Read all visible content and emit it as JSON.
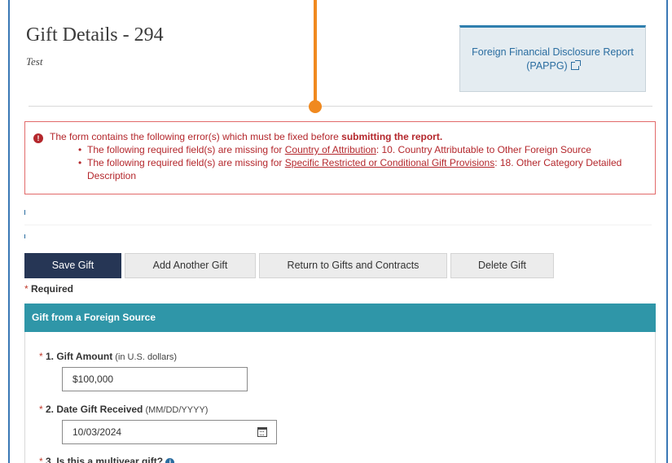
{
  "page": {
    "title": "Gift Details - 294",
    "subtitle": "Test"
  },
  "report_button": {
    "line1": "Foreign Financial Disclosure Report",
    "line2": "(PAPPG)",
    "icon": "external-link-icon"
  },
  "errors": {
    "intro_prefix": "The form contains the following error(s) which must be fixed before ",
    "intro_bold": "submitting the report.",
    "items": [
      {
        "prefix": "The following required field(s) are missing for ",
        "link": "Country of Attribution",
        "suffix": ": 10. Country Attributable to Other Foreign Source"
      },
      {
        "prefix": "The following required field(s) are missing for ",
        "link": "Specific Restricted or Conditional Gift Provisions",
        "suffix": ": 18. Other Category Detailed Description"
      }
    ]
  },
  "actions": {
    "save": "Save Gift",
    "add_another": "Add Another Gift",
    "return": "Return to Gifts and Contracts",
    "delete": "Delete Gift"
  },
  "required_note": {
    "star": "*",
    "label": " Required"
  },
  "section": {
    "header": "Gift from a Foreign Source",
    "fields": {
      "gift_amount": {
        "star": "*",
        "label": " 1. Gift Amount",
        "hint": " (in U.S. dollars)",
        "value": "$100,000"
      },
      "date_received": {
        "star": "*",
        "label": " 2. Date Gift Received",
        "hint": " (MM/DD/YYYY)",
        "value": "10/03/2024",
        "icon": "calendar-icon"
      },
      "multiyear": {
        "star": "*",
        "label": " 3. Is this a multiyear gift?",
        "icon": "info-icon"
      }
    }
  },
  "colors": {
    "accent_blue": "#3a78b5",
    "section_teal": "#2f96a8",
    "primary_button": "#263655",
    "error_red": "#b4272c",
    "annotation_orange": "#f0891f"
  }
}
